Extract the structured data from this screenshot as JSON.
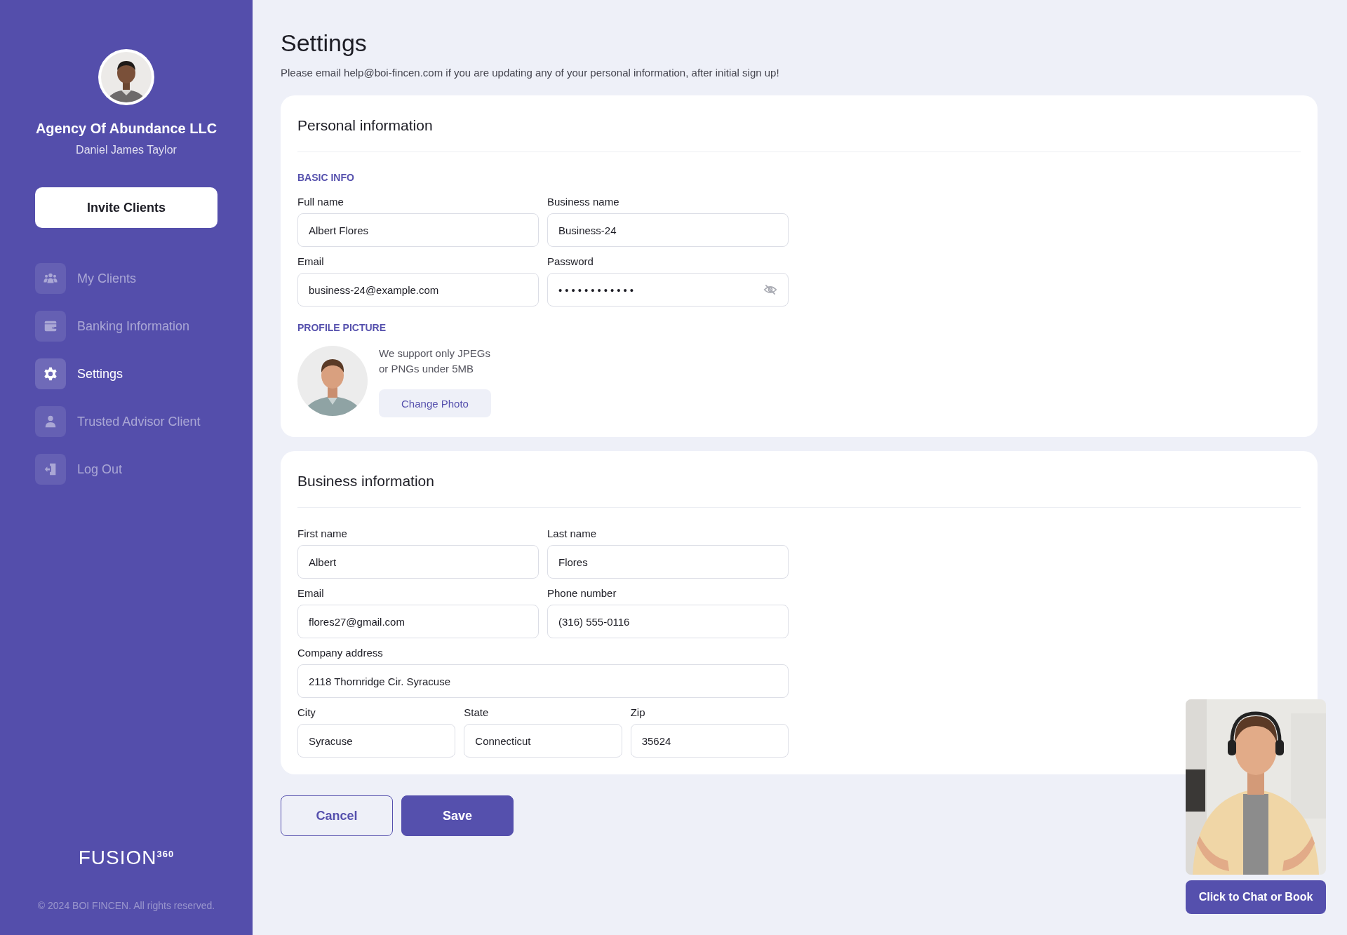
{
  "sidebar": {
    "company": "Agency Of Abundance LLC",
    "user": "Daniel James Taylor",
    "invite_button": "Invite Clients",
    "items": [
      {
        "label": "My Clients",
        "selected": false
      },
      {
        "label": "Banking Information",
        "selected": false
      },
      {
        "label": "Settings",
        "selected": true
      },
      {
        "label": "Trusted Advisor Client",
        "selected": false
      },
      {
        "label": "Log Out",
        "selected": false
      }
    ],
    "logo": "FUSION$^{360}$",
    "copyright": "© 2024 BOI FINCEN. All rights reserved."
  },
  "page": {
    "title": "Settings",
    "subtitle": "Please email help@boi-fincen.com if you are updating any of your personal information, after initial sign up!"
  },
  "personal": {
    "title": "Personal information",
    "basic_label": "BASIC INFO",
    "fields": [
      {
        "label": "Full name",
        "value": "Albert Flores",
        "kind": "text"
      },
      {
        "label": "Business name",
        "value": "Business-24",
        "kind": "text"
      },
      {
        "label": "Email",
        "value": "business-24@example.com",
        "kind": "text"
      },
      {
        "label": "Password",
        "value": "••••••••••••",
        "kind": "password"
      }
    ],
    "picture_label": "PROFILE PICTURE",
    "picture_hint": [
      "We support only JPEGs",
      "or PNGs under 5MB"
    ],
    "change_photo": "Change Photo"
  },
  "business": {
    "title": "Business information",
    "rows": [
      [
        {
          "label": "First name",
          "value": "Albert"
        },
        {
          "label": "Last name",
          "value": "Flores"
        }
      ],
      [
        {
          "label": "Email",
          "value": "flores27@gmail.com"
        },
        {
          "label": "Phone number",
          "value": "(316) 555-0116"
        }
      ],
      [
        {
          "label": "Company address",
          "value": "2118 Thornridge Cir. Syracuse"
        }
      ],
      [
        {
          "label": "City",
          "value": "Syracuse"
        },
        {
          "label": "State",
          "value": "Connecticut"
        },
        {
          "label": "Zip",
          "value": "35624"
        }
      ]
    ]
  },
  "buttons": {
    "cancel": "Cancel",
    "save": "Save"
  },
  "chat": {
    "button": "Click to Chat or Book"
  }
}
